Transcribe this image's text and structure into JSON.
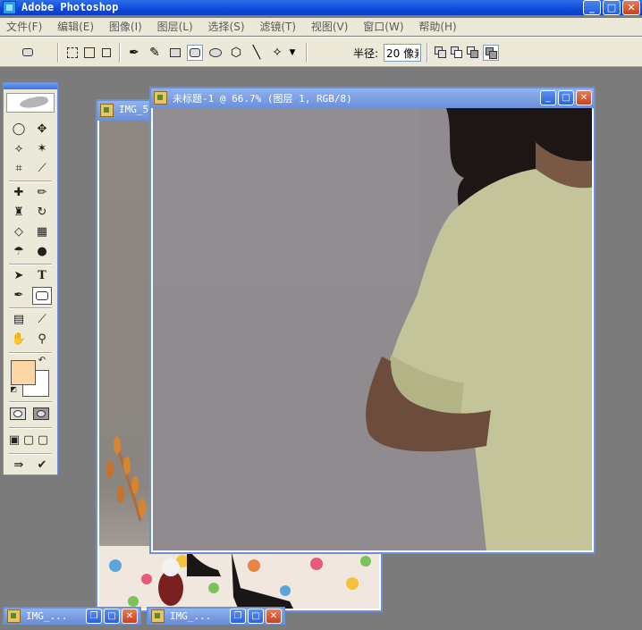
{
  "app": {
    "title": "Adobe Photoshop",
    "icon": "photoshop-app-icon"
  },
  "menu": [
    "文件(F)",
    "编辑(E)",
    "图像(I)",
    "图层(L)",
    "选择(S)",
    "滤镜(T)",
    "视图(V)",
    "窗口(W)",
    "帮助(H)"
  ],
  "options": {
    "radius_label": "半径:",
    "radius_value": "20 像素"
  },
  "toolbox": {
    "foreground_color": "#fbd7a5",
    "background_color": "#ffffff"
  },
  "documents": {
    "active": {
      "title": "未标题-1 @ 66.7% (图层 1, RGB/8)"
    },
    "background": {
      "title": "IMG_5"
    }
  },
  "minimized": [
    {
      "title": "IMG_..."
    },
    {
      "title": "IMG_..."
    }
  ],
  "window_buttons": {
    "minimize": "_",
    "maximize": "□",
    "restore": "❐",
    "close": "✕"
  }
}
